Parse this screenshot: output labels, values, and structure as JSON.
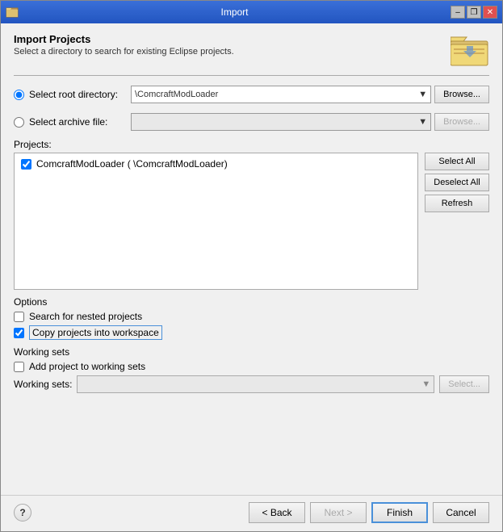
{
  "window": {
    "title": "Import",
    "icon": "import-icon"
  },
  "titlebar": {
    "controls": {
      "minimize_label": "–",
      "restore_label": "❐",
      "close_label": "✕"
    }
  },
  "header": {
    "title": "Import Projects",
    "subtitle": "Select a directory to search for existing Eclipse projects."
  },
  "root_directory": {
    "label": "Select root directory:",
    "value": "\\ComcraftModLoader",
    "browse_label": "Browse..."
  },
  "archive_file": {
    "label": "Select archive file:",
    "value": "",
    "browse_label": "Browse..."
  },
  "projects": {
    "label": "Projects:",
    "items": [
      {
        "checked": true,
        "name": "ComcraftModLoader (",
        "path": "                   \\ComcraftModLoader)"
      }
    ],
    "select_all_label": "Select All",
    "deselect_all_label": "Deselect All",
    "refresh_label": "Refresh"
  },
  "options": {
    "title": "Options",
    "search_nested": {
      "checked": false,
      "label": "Search for nested projects"
    },
    "copy_projects": {
      "checked": true,
      "label": "Copy projects into workspace"
    }
  },
  "working_sets": {
    "title": "Working sets",
    "add_label": "Add project to working sets",
    "add_checked": false,
    "sets_label": "Working sets:",
    "sets_value": "",
    "select_label": "Select..."
  },
  "footer": {
    "help_label": "?",
    "back_label": "< Back",
    "next_label": "Next >",
    "finish_label": "Finish",
    "cancel_label": "Cancel"
  }
}
